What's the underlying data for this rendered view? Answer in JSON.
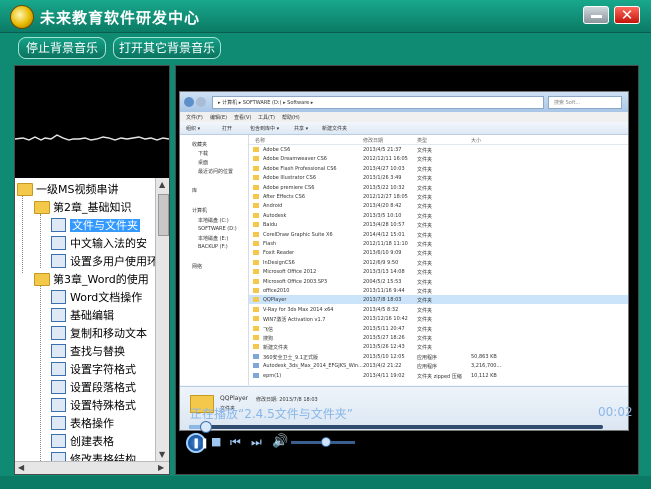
{
  "app": {
    "title": "未来教育软件研发中心",
    "logo_text": "未来教育"
  },
  "toolbar": {
    "stop_music": "停止背景音乐",
    "open_music": "打开其它背景音乐"
  },
  "tree": {
    "root": "一级MS视频串讲",
    "chapter2": "第2章_基础知识",
    "ch2_items": [
      "文件与文件夹",
      "中文输入法的安",
      "设置多用户使用环"
    ],
    "chapter3": "第3章_Word的使用",
    "ch3_items": [
      "Word文档操作",
      "基础编辑",
      "复制和移动文本",
      "查找与替换",
      "设置字符格式",
      "设置段落格式",
      "设置特殊格式",
      "表格操作",
      "创建表格",
      "修改表格结构"
    ]
  },
  "player": {
    "status": "正在播放“2.4.5文件与文件夹”",
    "time": "00:02",
    "seek_progress": 0.04,
    "volume": 0.55
  },
  "explorer": {
    "breadcrumb": "▸ 计算机 ▸ SOFTWARE (D:) ▸ Software ▸",
    "search": "搜索 Soft...",
    "menu": [
      "文件(F)",
      "编辑(E)",
      "查看(V)",
      "工具(T)",
      "帮助(H)"
    ],
    "commands": [
      "组织 ▾",
      "打开",
      "包含到库中 ▾",
      "共享 ▾",
      "新建文件夹"
    ],
    "columns": [
      "名称",
      "修改日期",
      "类型",
      "大小"
    ],
    "nav_items": [
      "收藏夹",
      "下载",
      "桌面",
      "最近访问的位置",
      "库",
      "计算机",
      "本地磁盘 (C:)",
      "SOFTWARE (D:)",
      "本地磁盘 (E:)",
      "BACKUP (F:)",
      "网络"
    ],
    "files": [
      [
        "Adobe CS6",
        "2013/4/5 21:37",
        "文件夹",
        ""
      ],
      [
        "Adobe Dreamweaver CS6",
        "2012/12/11 16:05",
        "文件夹",
        ""
      ],
      [
        "Adobe Flash Professional CS6",
        "2013/4/27 10:03",
        "文件夹",
        ""
      ],
      [
        "Adobe Illustrator CS6",
        "2013/1/26 3:49",
        "文件夹",
        ""
      ],
      [
        "Adobe premiere CS6",
        "2013/5/22 10:32",
        "文件夹",
        ""
      ],
      [
        "After Effects CS6",
        "2012/12/27 18:05",
        "文件夹",
        ""
      ],
      [
        "Android",
        "2013/4/20 8:42",
        "文件夹",
        ""
      ],
      [
        "Autodesk",
        "2013/3/5 10:10",
        "文件夹",
        ""
      ],
      [
        "Baidu",
        "2013/4/28 10:57",
        "文件夹",
        ""
      ],
      [
        "CorelDraw Graphic Suite X6",
        "2014/4/12 15:01",
        "文件夹",
        ""
      ],
      [
        "Flash",
        "2012/11/18 11:10",
        "文件夹",
        ""
      ],
      [
        "Foxit Reader",
        "2013/6/10 9:09",
        "文件夹",
        ""
      ],
      [
        "InDesignCS6",
        "2012/6/9 9:50",
        "文件夹",
        ""
      ],
      [
        "Microsoft Office 2012",
        "2013/3/13 14:08",
        "文件夹",
        ""
      ],
      [
        "Microsoft Office 2003.SP3",
        "2004/5/2 15:53",
        "文件夹",
        ""
      ],
      [
        "office2010",
        "2013/11/16 9:44",
        "文件夹",
        ""
      ],
      [
        "QQPlayer",
        "2013/7/8 18:03",
        "文件夹",
        ""
      ],
      [
        "V-Ray for 3ds Max 2014 x64",
        "2013/4/5 8:32",
        "文件夹",
        ""
      ],
      [
        "WIN7激活 Activation v1.7",
        "2013/12/16 10:42",
        "文件夹",
        ""
      ],
      [
        "飞信",
        "2013/5/11 20:47",
        "文件夹",
        ""
      ],
      [
        "搜狗",
        "2013/5/27 18:26",
        "文件夹",
        ""
      ],
      [
        "新建文件夹",
        "2013/5/26 12:43",
        "文件夹",
        ""
      ],
      [
        "360安全卫士_9.1正式版",
        "2013/5/10 12:05",
        "应用程序",
        "50,863 KB"
      ],
      [
        "Autodesk_3ds_Max_2014_EFGJKS_Win...",
        "2013/4/2 21:22",
        "应用程序",
        "3,216,700..."
      ],
      [
        "epm(1)",
        "2013/4/11 19:02",
        "文件夹 zipped 压缩",
        "10,112 KB"
      ]
    ],
    "details_name": "QQPlayer",
    "details_meta": "修改日期: 2013/7/8 18:03",
    "details_type": "文件夹"
  }
}
